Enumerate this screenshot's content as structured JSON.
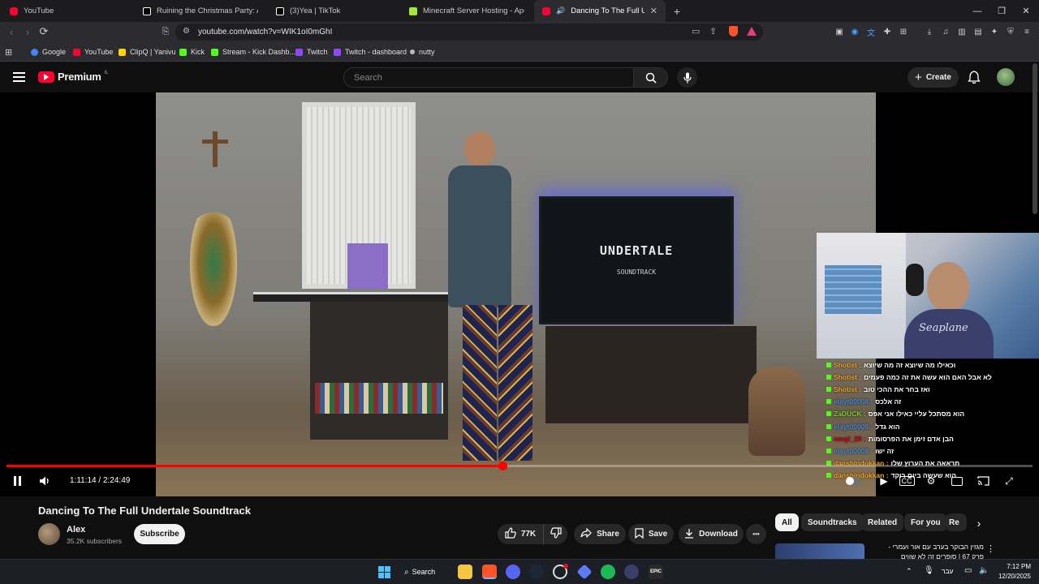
{
  "browser": {
    "tabs": [
      {
        "label": "YouTube",
        "icon": "youtube-icon",
        "color": "#ff0033"
      },
      {
        "label": "Ruining the Christmas Party: A Stream",
        "icon": "tiktok-icon",
        "color": "#ffffff"
      },
      {
        "label": "(3)Yea | TikTok",
        "icon": "tiktok-icon",
        "color": "#ffffff"
      },
      {
        "label": "Minecraft Server Hosting - Apex Hosti",
        "icon": "apex-icon",
        "color": "#a3e635"
      },
      {
        "label": "Dancing To The Full Undertale",
        "icon": "youtube-icon",
        "color": "#ff0033"
      }
    ],
    "new_tab": "+",
    "url": "youtube.com/watch?v=WIK1oI0mGhI",
    "bookmarks": [
      {
        "label": "Google",
        "color": "#4285f4"
      },
      {
        "label": "YouTube",
        "color": "#ff0033"
      },
      {
        "label": "ClipQ | Yanivu",
        "color": "#ffd400"
      },
      {
        "label": "Kick",
        "color": "#53fc18"
      },
      {
        "label": "Stream - Kick Dashb...",
        "color": "#53fc18"
      },
      {
        "label": "Twitch",
        "color": "#9146ff"
      },
      {
        "label": "Twitch - dashboard",
        "color": "#9146ff"
      },
      {
        "label": "nutty",
        "color": "#bbbbbb"
      }
    ]
  },
  "youtube": {
    "logo_text": "Premium",
    "logo_country": "IL",
    "search_placeholder": "Search",
    "create_label": "Create"
  },
  "video": {
    "progress": 0.4836,
    "time_current": "1:11:14",
    "time_total": "2:24:49",
    "time_display": "1:11:14 / 2:24:49",
    "screen_title": "UNDERTALE",
    "screen_subtitle": "SOUNDTRACK",
    "webcam_shirt_text": "Seaplane",
    "chat": [
      {
        "user": "Shotist",
        "user_color": "#f5a623",
        "msg": "וכאילו מה שיוצא זה מה שיוצא"
      },
      {
        "user": "Shotist",
        "user_color": "#f5a623",
        "msg": "לא אבל האם הוא עשה את זה כמה פעמים"
      },
      {
        "user": "Shotist",
        "user_color": "#f5a623",
        "msg": "ואז בחר את ההכי טוב"
      },
      {
        "user": "elayt00008",
        "user_color": "#4a90e2",
        "msg": "זה אלכס"
      },
      {
        "user": "ZaDUCK",
        "user_color": "#7ed321",
        "msg": "הוא מסתכל עליי כאילו אני אפס"
      },
      {
        "user": "elayt00008",
        "user_color": "#4a90e2",
        "msg": "הוא גדל"
      },
      {
        "user": "nmgl_20",
        "user_color": "#d0021b",
        "msg": "הבן אדם זימן את הפרסומות"
      },
      {
        "user": "elayt00008",
        "user_color": "#4a90e2",
        "msg": "זה ישו"
      },
      {
        "user": "danshindokkan",
        "user_color": "#f5a623",
        "msg": "תראאה את הערוץ שלו"
      },
      {
        "user": "danshindokkan",
        "user_color": "#f5a623",
        "msg": "הוא שעשה ביום רוקד"
      }
    ]
  },
  "details": {
    "title": "Dancing To The Full Undertale Soundtrack",
    "channel": "Alex",
    "subscribers": "35.2K subscribers",
    "subscribe_label": "Subscribe",
    "likes": "77K",
    "share_label": "Share",
    "save_label": "Save",
    "download_label": "Download",
    "more_label": "•••"
  },
  "related_chips": [
    "All",
    "Soundtracks",
    "Related",
    "For you",
    "Re"
  ],
  "recommendation": {
    "line1": "מגזין הבוקר בערב עם אור ועמרי -",
    "line2": "פרק 67 | סופרים זה לא שווים"
  },
  "taskbar": {
    "search_label": "Search",
    "lang": "עבר",
    "time": "7:12 PM",
    "date": "12/20/2025"
  }
}
